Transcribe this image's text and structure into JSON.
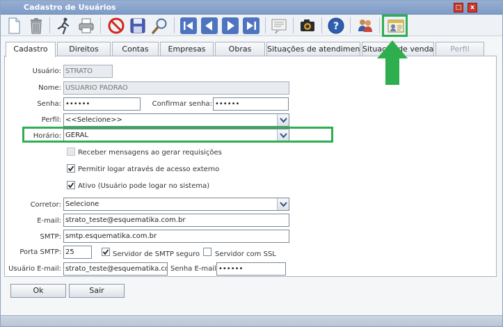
{
  "window": {
    "title": "Cadastro de Usuários",
    "maximize_glyph": "□",
    "close_glyph": "x"
  },
  "toolbar": {
    "icons": [
      "new-document-icon",
      "trash-icon",
      "run-icon",
      "print-icon",
      "cancel-icon",
      "save-icon",
      "search-icon",
      "first-icon",
      "previous-icon",
      "next-icon",
      "last-icon",
      "notes-icon",
      "camera-icon",
      "help-icon",
      "users-icon",
      "user-card-icon"
    ]
  },
  "tabs": [
    {
      "label": "Cadastro",
      "active": true
    },
    {
      "label": "Direitos"
    },
    {
      "label": "Contas"
    },
    {
      "label": "Empresas"
    },
    {
      "label": "Obras"
    },
    {
      "label": "Situações de atendimento"
    },
    {
      "label": "Situação de venda"
    },
    {
      "label": "Perfil",
      "disabled": true
    }
  ],
  "form": {
    "usuario_label": "Usuário:",
    "usuario_value": "STRATO",
    "nome_label": "Nome:",
    "nome_value": "USUARIO PADRAO",
    "senha_label": "Senha:",
    "senha_value": "••••••",
    "confirmar_label": "Confirmar senha:",
    "confirmar_value": "••••••",
    "perfil_label": "Perfil:",
    "perfil_value": "<<Selecione>>",
    "horario_label": "Horário:",
    "horario_value": "GERAL",
    "receber_label": "Receber mensagens ao gerar requisições",
    "permitir_label": "Permitir logar através de acesso externo",
    "ativo_label": "Ativo (Usuário pode logar no sistema)",
    "corretor_label": "Corretor:",
    "corretor_value": "Selecione",
    "email_label": "E-mail:",
    "email_value": "strato_teste@esquematika.com.br",
    "smtp_label": "SMTP:",
    "smtp_value": "smtp.esquematika.com.br",
    "porta_label": "Porta SMTP:",
    "porta_value": "25",
    "smtp_seguro_label": "Servidor de SMTP seguro",
    "ssl_label": "Servidor com SSL",
    "usuario_email_label": "Usuário E-mail:",
    "usuario_email_value": "strato_teste@esquematika.com.b",
    "senha_email_label": "Senha E-mail:",
    "senha_email_value": "••••••"
  },
  "checks": {
    "receber": false,
    "permitir": true,
    "ativo": true,
    "smtp_seguro": true,
    "ssl": false
  },
  "buttons": {
    "ok": "Ok",
    "sair": "Sair"
  },
  "colors": {
    "highlight": "#2eae4e",
    "titlebar": "#7e9cc7"
  }
}
